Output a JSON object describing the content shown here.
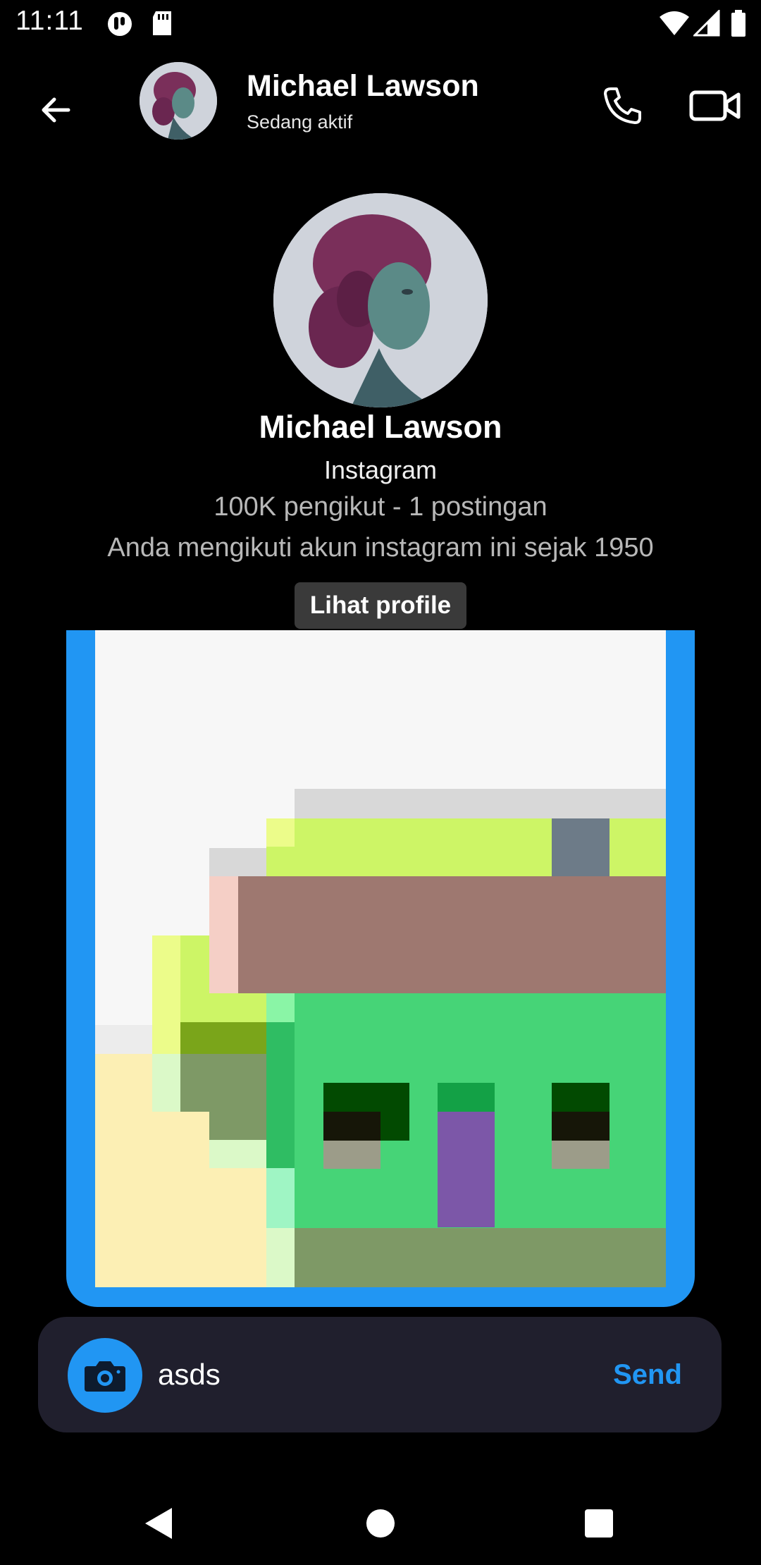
{
  "status_bar": {
    "time": "11:11"
  },
  "header": {
    "contact_name": "Michael Lawson",
    "contact_status": "Sedang aktif"
  },
  "profile": {
    "name": "Michael Lawson",
    "source": "Instagram",
    "stats": "100K pengikut - 1 postingan",
    "follow_note": "Anda mengikuti akun instagram ini sejak 1950",
    "view_profile_label": "Lihat profile"
  },
  "composer": {
    "input_value": "asds",
    "send_label": "Send"
  },
  "colors": {
    "accent": "#2196f3",
    "background": "#000000",
    "input_bar": "#201f2d",
    "button_dark": "#3a3a3a"
  },
  "icons": {
    "back": "arrow-left-icon",
    "call": "phone-icon",
    "video": "video-camera-icon",
    "camera": "camera-icon",
    "nav_back": "triangle-back-icon",
    "nav_home": "circle-home-icon",
    "nav_recents": "square-recents-icon"
  }
}
